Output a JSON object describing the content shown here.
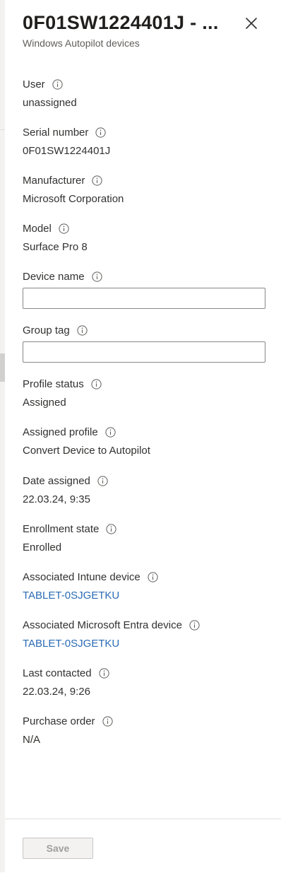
{
  "header": {
    "title": "0F01SW1224401J - ...",
    "subtitle": "Windows Autopilot devices",
    "close_icon": "close-icon"
  },
  "fields": {
    "user": {
      "label": "User",
      "value": "unassigned"
    },
    "serial_number": {
      "label": "Serial number",
      "value": "0F01SW1224401J"
    },
    "manufacturer": {
      "label": "Manufacturer",
      "value": "Microsoft Corporation"
    },
    "model": {
      "label": "Model",
      "value": "Surface Pro 8"
    },
    "device_name": {
      "label": "Device name",
      "value": "",
      "placeholder": ""
    },
    "group_tag": {
      "label": "Group tag",
      "value": "",
      "placeholder": ""
    },
    "profile_status": {
      "label": "Profile status",
      "value": "Assigned"
    },
    "assigned_profile": {
      "label": "Assigned profile",
      "value": "Convert Device to Autopilot"
    },
    "date_assigned": {
      "label": "Date assigned",
      "value": "22.03.24, 9:35"
    },
    "enrollment_state": {
      "label": "Enrollment state",
      "value": "Enrolled"
    },
    "intune_device": {
      "label": "Associated Intune device",
      "value": "TABLET-0SJGETKU"
    },
    "entra_device": {
      "label": "Associated Microsoft Entra device",
      "value": "TABLET-0SJGETKU"
    },
    "last_contacted": {
      "label": "Last contacted",
      "value": "22.03.24, 9:26"
    },
    "purchase_order": {
      "label": "Purchase order",
      "value": "N/A"
    }
  },
  "footer": {
    "save_label": "Save"
  },
  "colors": {
    "link": "#2b6cb5",
    "text": "#323130",
    "subtitle": "#605e5c",
    "disabled_text": "#a19f9d"
  }
}
